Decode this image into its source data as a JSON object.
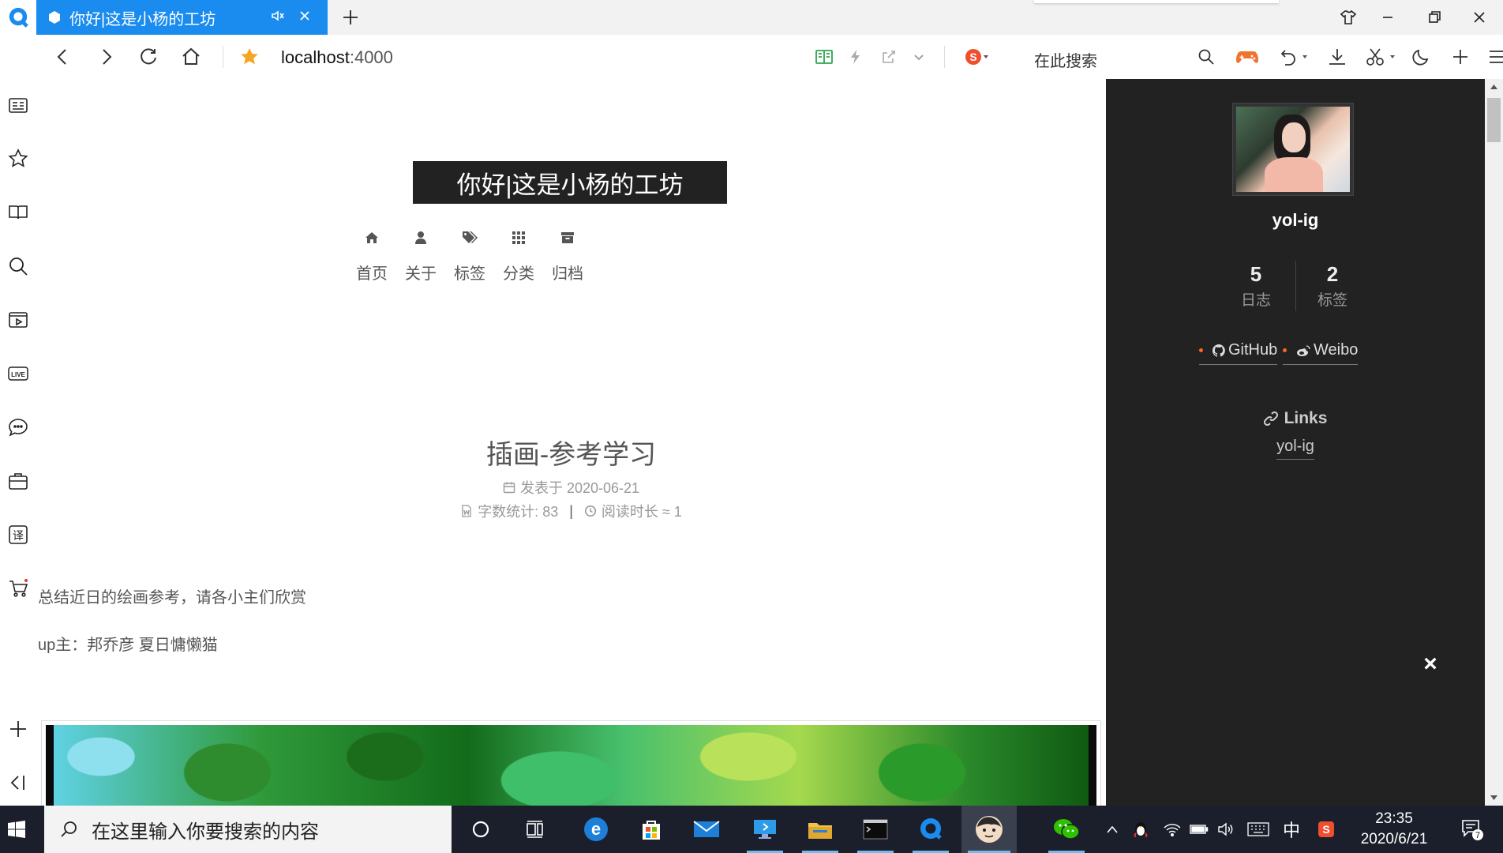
{
  "browser": {
    "tab_title": "你好|这是小杨的工坊",
    "url_host": "localhost",
    "url_port": ":4000",
    "search_placeholder": "在此搜索"
  },
  "site": {
    "title": "你好|这是小杨的工坊",
    "menu": [
      {
        "label": "首页",
        "icon": "home-icon"
      },
      {
        "label": "关于",
        "icon": "user-icon"
      },
      {
        "label": "标签",
        "icon": "tags-icon"
      },
      {
        "label": "分类",
        "icon": "th-icon"
      },
      {
        "label": "归档",
        "icon": "archive-icon"
      }
    ]
  },
  "post": {
    "title": "插画-参考学习",
    "published": "发表于 2020-06-21",
    "wordcount": "字数统计: 83",
    "separator": "|",
    "readtime": "阅读时长 ≈ 1",
    "paragraphs": [
      "总结近日的绘画参考，请各小主们欣赏",
      "up主：邦乔彦 夏日慵懒猫"
    ]
  },
  "sidebar": {
    "author": "yol-ig",
    "stats": [
      {
        "num": "5",
        "label": "日志"
      },
      {
        "num": "2",
        "label": "标签"
      }
    ],
    "social": [
      "GitHub",
      "Weibo"
    ],
    "links_title": "Links",
    "links": [
      "yol-ig"
    ],
    "close": "×"
  },
  "taskbar": {
    "search_placeholder": "在这里输入你要搜索的内容",
    "ime": "中",
    "time": "23:35",
    "date": "2020/6/21",
    "notifications": "7"
  },
  "colors": {
    "tab_active": "#1a8cf0",
    "sidebar_bg": "#222222",
    "accent_dot": "#fc6423",
    "taskbar_bg": "#1a1f2b"
  }
}
